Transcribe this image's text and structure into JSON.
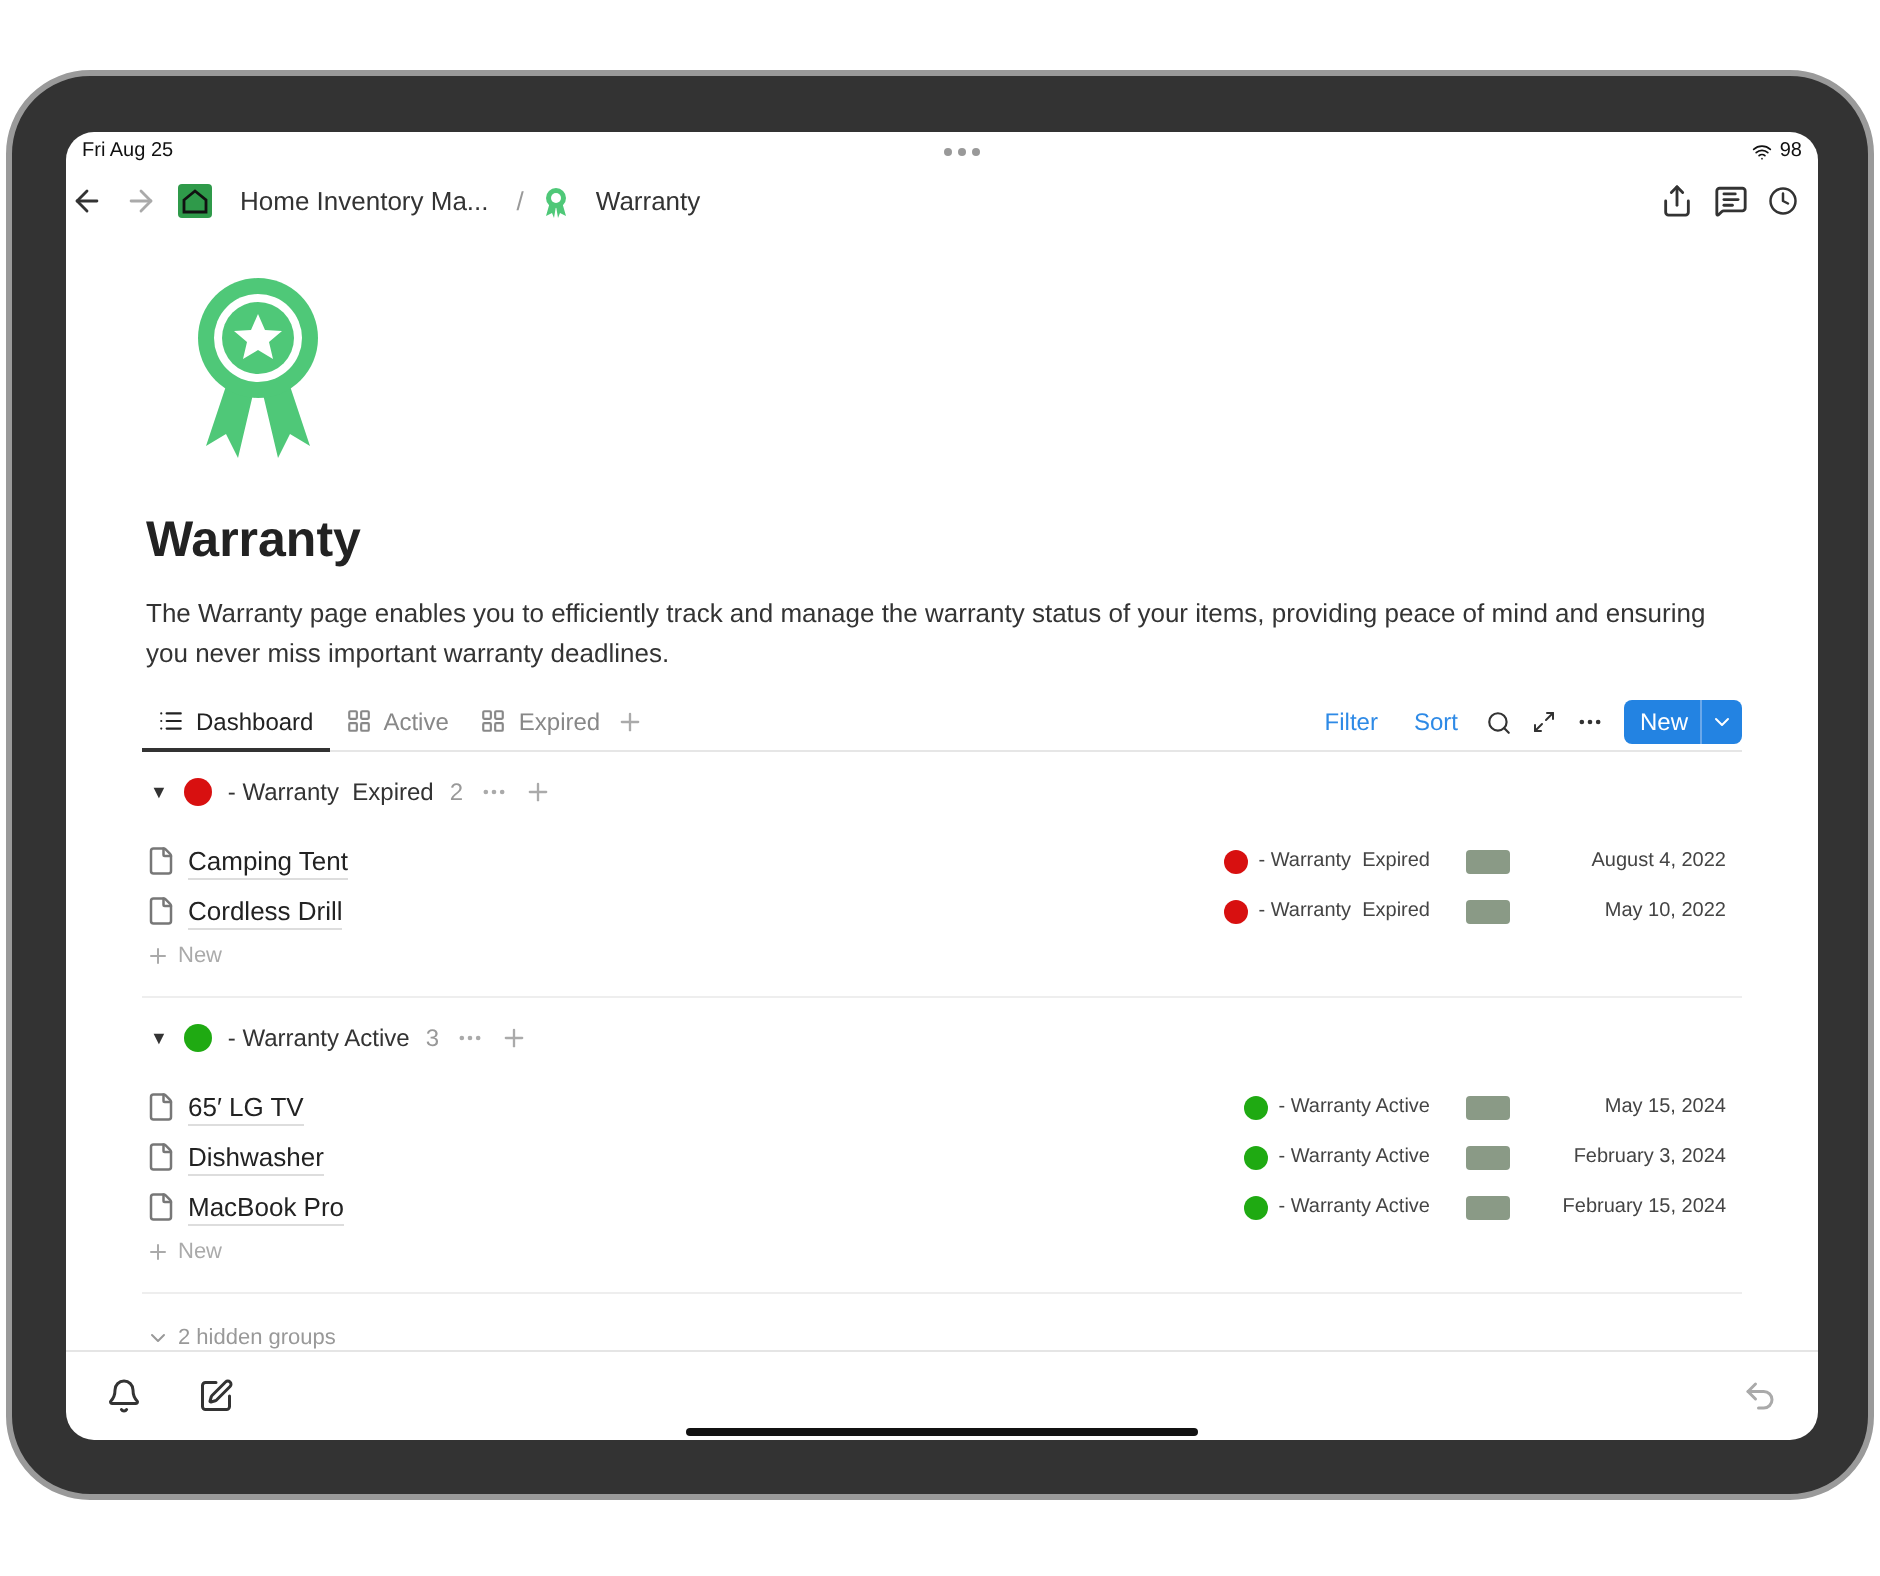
{
  "status_bar": {
    "time": "Fri Aug 25",
    "battery": "98"
  },
  "nav": {
    "breadcrumbs": [
      {
        "label": "Home Inventory Ma...",
        "kind": "home"
      },
      {
        "label": "Warranty",
        "kind": "warranty"
      }
    ],
    "separator": "/"
  },
  "page": {
    "title": "Warranty",
    "description": "The Warranty page enables you to efficiently track and manage the warranty status of your items, providing peace of mind and ensuring you never miss important warranty deadlines."
  },
  "tabs": [
    {
      "label": "Dashboard",
      "kind": "list",
      "selected": true
    },
    {
      "label": "Active",
      "kind": "gallery",
      "selected": false
    },
    {
      "label": "Expired",
      "kind": "gallery",
      "selected": false
    }
  ],
  "toolbar": {
    "filter": "Filter",
    "sort": "Sort",
    "new": "New"
  },
  "groups": [
    {
      "toggle": "▼",
      "label": "- Warranty  Expired",
      "color": "#d81010",
      "count": "2",
      "expanded": true,
      "new_label": "New",
      "items": [
        {
          "name": "Camping Tent",
          "status": "- Warranty  Expired",
          "color": "#d81010",
          "date": "August 4, 2022"
        },
        {
          "name": "Cordless Drill",
          "status": "- Warranty  Expired",
          "color": "#d81010",
          "date": "May 10, 2022"
        }
      ]
    },
    {
      "toggle": "▼",
      "label": "- Warranty Active",
      "color": "#1faa12",
      "count": "3",
      "expanded": true,
      "new_label": "New",
      "items": [
        {
          "name": "65′ LG TV",
          "status": "- Warranty Active",
          "color": "#1faa12",
          "date": "May 15, 2024"
        },
        {
          "name": "Dishwasher",
          "status": "- Warranty Active",
          "color": "#1faa12",
          "date": "February 3, 2024"
        },
        {
          "name": "MacBook Pro",
          "status": "- Warranty Active",
          "color": "#1faa12",
          "date": "February 15, 2024"
        }
      ]
    }
  ],
  "hidden_groups": "2 hidden groups"
}
